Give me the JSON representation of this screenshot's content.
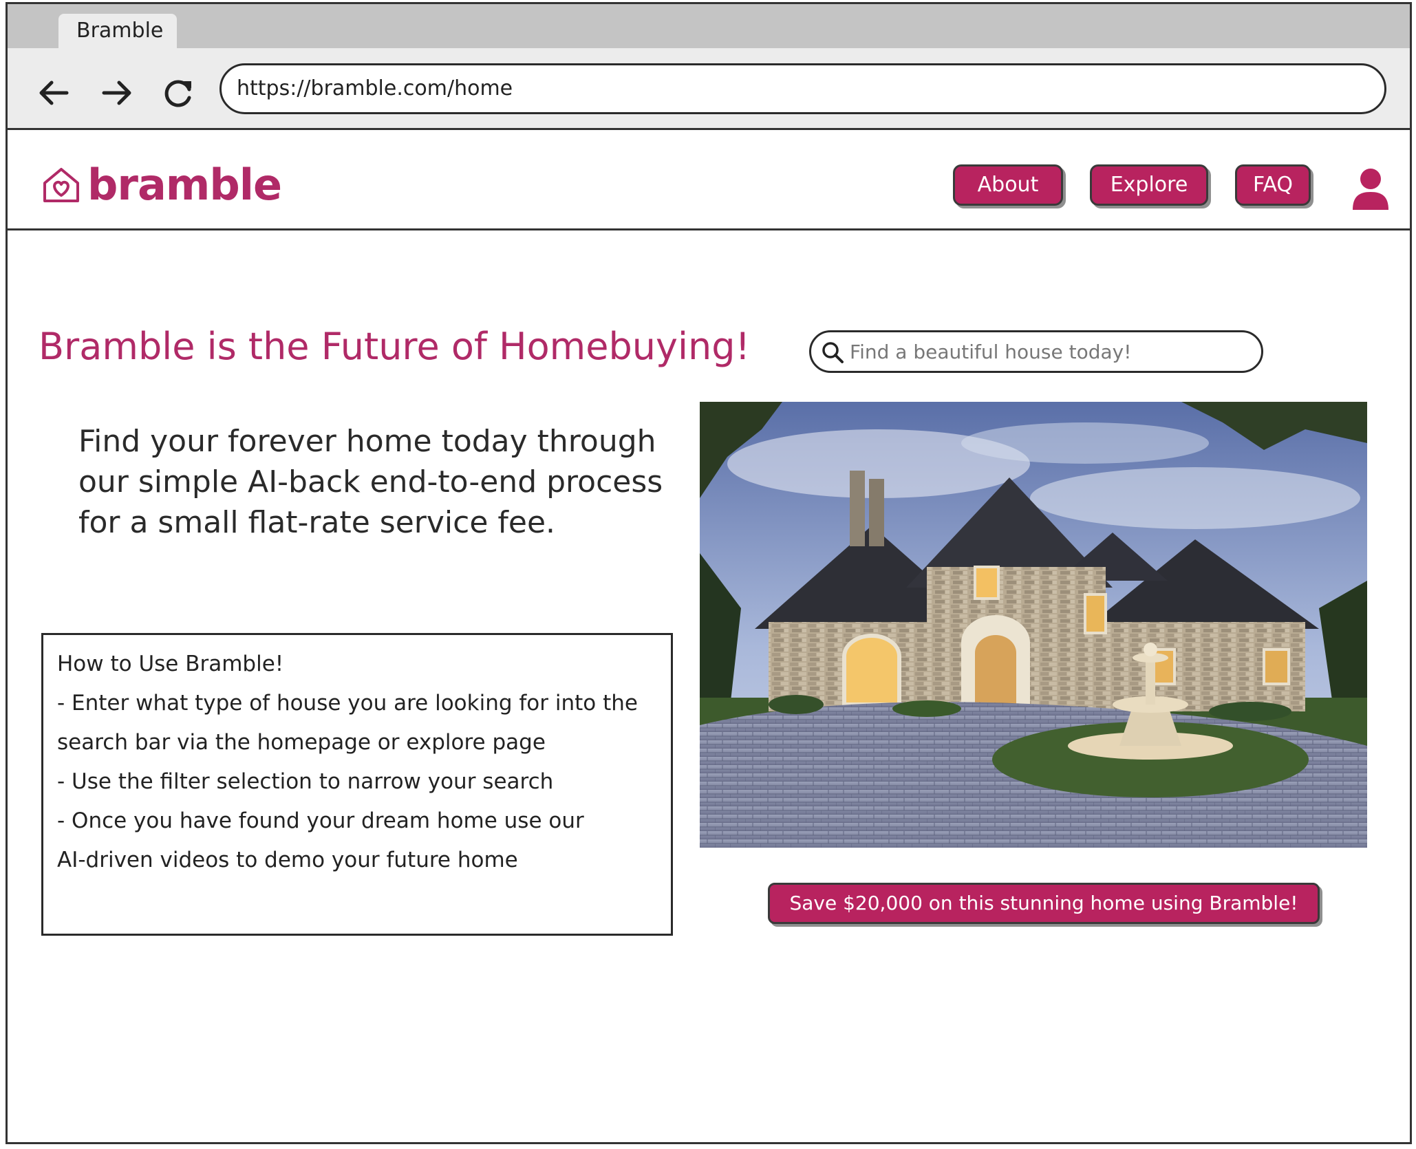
{
  "browser": {
    "tab_title": "Bramble",
    "url": "https://bramble.com/home",
    "icons": [
      "back-arrow-icon",
      "forward-arrow-icon",
      "reload-icon"
    ]
  },
  "header": {
    "logo_text": "bramble",
    "nav": {
      "about": "About",
      "explore": "Explore",
      "faq": "FAQ"
    },
    "user_icon": "user-icon"
  },
  "main": {
    "headline": "Bramble is the Future of Homebuying!",
    "search_placeholder": "Find a beautiful house today!",
    "intro": "Find your forever home today through our simple AI-back end-to-end process for a small flat-rate service fee.",
    "howto": {
      "title": "How to Use Bramble!",
      "lines": [
        "- Enter what type of house you are looking for into the",
        "search bar via the homepage  or explore page",
        "- Use the filter selection to narrow your search",
        "- Once you have found your dream home use our",
        "AI-driven videos to demo your future home"
      ]
    },
    "promo_button": "Save $20,000 on this stunning home using Bramble!"
  },
  "colors": {
    "brand": "#b8235f",
    "brand_text": "#b02a67",
    "chrome": "#ececec"
  }
}
